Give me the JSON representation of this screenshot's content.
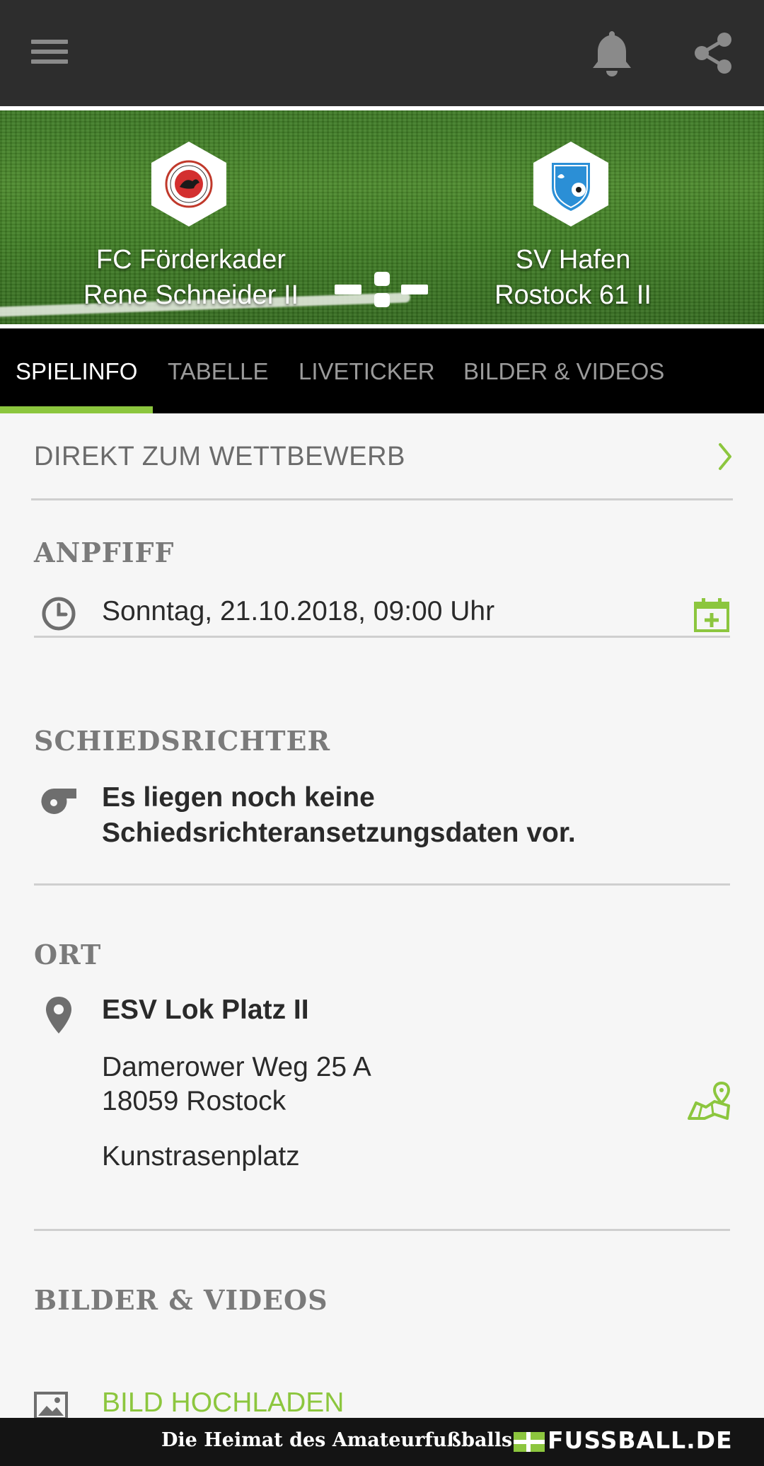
{
  "appbar": {
    "menu_icon": "hamburger-menu-icon",
    "notification_icon": "bell-icon",
    "share_icon": "share-icon"
  },
  "match": {
    "home_team": {
      "name_line1": "FC Förderkader",
      "name_line2": "Rene Schneider II",
      "crest_icon": "home-team-crest"
    },
    "away_team": {
      "name_line1": "SV Hafen",
      "name_line2": "Rostock 61 II",
      "crest_icon": "away-team-crest"
    },
    "score_display": "-:-"
  },
  "tabs": [
    {
      "label": "SPIELINFO",
      "active": true
    },
    {
      "label": "TABELLE",
      "active": false
    },
    {
      "label": "LIVETICKER",
      "active": false
    },
    {
      "label": "BILDER & VIDEOS",
      "active": false
    }
  ],
  "competition_link": {
    "label": "DIREKT ZUM WETTBEWERB",
    "icon": "chevron-right-icon"
  },
  "kickoff": {
    "title": "ANPFIFF",
    "datetime": "Sonntag, 21.10.2018, 09:00 Uhr",
    "icon": "clock-icon",
    "action_icon": "calendar-add-icon"
  },
  "referee": {
    "title": "SCHIEDSRICHTER",
    "line1": "Es liegen noch keine",
    "line2": "Schiedsrichteransetzungsdaten vor.",
    "icon": "whistle-icon"
  },
  "location": {
    "title": "ORT",
    "venue": "ESV Lok Platz II",
    "street": "Damerower Weg 25 A",
    "city": "18059 Rostock",
    "surface": "Kunstrasenplatz",
    "icon": "map-pin-icon",
    "action_icon": "map-route-icon"
  },
  "media": {
    "title": "BILDER & VIDEOS",
    "upload_label": "BILD HOCHLADEN",
    "icon": "image-icon"
  },
  "footer": {
    "tagline": "Die Heimat des Amateurfußballs",
    "logo_text": "FUSSBALL.DE"
  },
  "colors": {
    "accent": "#8cc63e",
    "appbar": "#2d2d2d",
    "tabs_bg": "#000000",
    "section_title": "#7a7a7a"
  }
}
